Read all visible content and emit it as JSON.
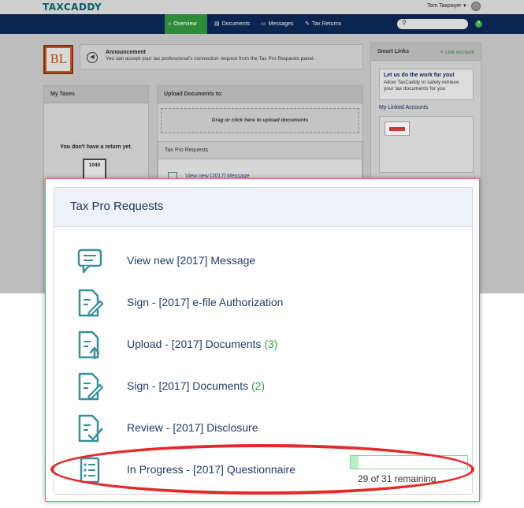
{
  "app": {
    "logo": "TAXCADDY",
    "user_name": "Tom Taxpayer",
    "nav": [
      {
        "label": "Overview",
        "icon": "home-icon",
        "glyph": "⌂"
      },
      {
        "label": "Documents",
        "icon": "document-icon",
        "glyph": "▤"
      },
      {
        "label": "Messages",
        "icon": "message-icon",
        "glyph": "▭"
      },
      {
        "label": "Tax Returns",
        "icon": "edit-icon",
        "glyph": "✎"
      }
    ],
    "help_glyph": "?",
    "announcement": {
      "title": "Announcement",
      "text": "You can accept your tax professional's connection request from the Tax Pro Requests panel."
    },
    "firm_logo_initials": "BL",
    "my_taxes": {
      "title": "My Taxes",
      "empty_text": "You don't have a return yet.",
      "form_label": "1040"
    },
    "upload": {
      "title": "Upload Documents to:",
      "drop_text": "Drag or click here to upload documents"
    },
    "tax_pro_small": {
      "title": "Tax Pro Requests",
      "first_row": "View new [2017] Message"
    },
    "smart_links": {
      "title": "Smart Links",
      "link_account": "Link Account",
      "promo_title": "Let us do the work for you!",
      "promo_text": "Allow TaxCaddy to safely retrieve your tax documents for you",
      "linked_title": "My Linked Accounts"
    }
  },
  "tax_pro_requests": {
    "title": "Tax Pro Requests",
    "items": [
      {
        "label": "View new [2017] Message",
        "count": "",
        "icon": "message-icon"
      },
      {
        "label": "Sign - [2017] e-file Authorization",
        "count": "",
        "icon": "sign-document-icon"
      },
      {
        "label": "Upload - [2017] Documents",
        "count": "(3)",
        "icon": "upload-document-icon"
      },
      {
        "label": "Sign - [2017] Documents",
        "count": "(2)",
        "icon": "sign-document-icon"
      },
      {
        "label": "Review - [2017] Disclosure",
        "count": "",
        "icon": "review-document-icon"
      },
      {
        "label": "In Progress - [2017] Questionnaire",
        "count": "",
        "icon": "questionnaire-icon"
      }
    ],
    "progress": {
      "text": "29 of 31 remaining",
      "fraction": 0.065
    }
  },
  "colors": {
    "nav_bg": "#0b2450",
    "nav_active": "#2f8a3a",
    "link_text": "#223d67",
    "count_green": "#2e9e4b",
    "icon_teal": "#3b8f96",
    "highlight_red": "#e32a2a"
  }
}
